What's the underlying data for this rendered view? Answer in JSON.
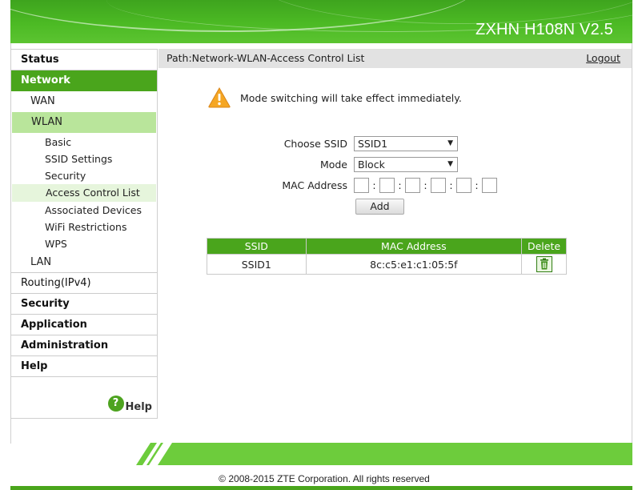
{
  "header": {
    "title": "ZXHN H108N V2.5"
  },
  "sidebar": {
    "top_items": [
      {
        "label": "Status"
      },
      {
        "label": "Network"
      }
    ],
    "network_sub": {
      "wan": "WAN",
      "wlan": "WLAN",
      "wlan_items": [
        "Basic",
        "SSID Settings",
        "Security",
        "Access Control List",
        "Associated Devices",
        "WiFi Restrictions",
        "WPS"
      ],
      "lan": "LAN",
      "routing": "Routing(IPv4)"
    },
    "bottom_items": [
      "Security",
      "Application",
      "Administration",
      "Help"
    ],
    "help_link": "Help",
    "help_icon": "?"
  },
  "main": {
    "path": "Path:Network-WLAN-Access Control List",
    "logout": "Logout",
    "notice": "Mode switching will take effect immediately.",
    "form": {
      "ssid_label": "Choose SSID",
      "ssid_value": "SSID1",
      "mode_label": "Mode",
      "mode_value": "Block",
      "mac_label": "MAC Address",
      "mac_separator": ":",
      "add_button": "Add"
    },
    "table": {
      "headers": [
        "SSID",
        "MAC Address",
        "Delete"
      ],
      "rows": [
        {
          "ssid": "SSID1",
          "mac": "8c:c5:e1:c1:05:5f"
        }
      ]
    }
  },
  "footer": {
    "copyright": "© 2008-2015 ZTE Corporation. All rights reserved"
  },
  "colors": {
    "brand_green": "#4aa51c",
    "open_green": "#b9e59b",
    "selected_green": "#e6f5dc",
    "warning_orange": "#f5a623"
  },
  "icons": {
    "warning": "warning-icon",
    "delete": "trash-icon",
    "help": "help-icon",
    "dropdown": "chevron-down-icon"
  }
}
